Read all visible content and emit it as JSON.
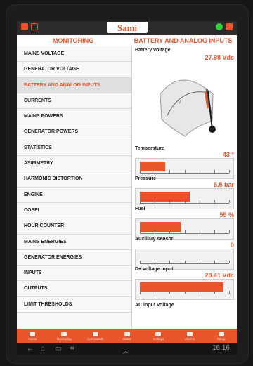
{
  "header": {
    "left_title": "MONITORING",
    "logo_text": "Sami",
    "right_title": "BATTERY AND ANALOG INPUTS"
  },
  "menu": {
    "items": [
      {
        "label": "MAINS VOLTAGE",
        "active": false
      },
      {
        "label": "GENERATOR VOLTAGE",
        "active": false
      },
      {
        "label": "BATTERY AND ANALOG INPUTS",
        "active": true
      },
      {
        "label": "CURRENTS",
        "active": false
      },
      {
        "label": "MAINS POWERS",
        "active": false
      },
      {
        "label": "GENERATOR POWERS",
        "active": false
      },
      {
        "label": "STATISTICS",
        "active": false
      },
      {
        "label": "ASIMMETRY",
        "active": false
      },
      {
        "label": "HARMONIC DISTORTION",
        "active": false
      },
      {
        "label": "ENGINE",
        "active": false
      },
      {
        "label": "COSFI",
        "active": false
      },
      {
        "label": "HOUR COUNTER",
        "active": false
      },
      {
        "label": "MAINS ENERGIES",
        "active": false
      },
      {
        "label": "GENERATOR ENERGIES",
        "active": false
      },
      {
        "label": "INPUTS",
        "active": false
      },
      {
        "label": "OUTPUTS",
        "active": false
      },
      {
        "label": "LIMIT THRESHOLDS",
        "active": false
      }
    ]
  },
  "panel": {
    "battery": {
      "label": "Battery voltage",
      "value": "27.98 Vdc"
    },
    "temperature": {
      "label": "Temperature",
      "value": "43 °",
      "level": 0.28
    },
    "pressure": {
      "label": "Pressure",
      "value": "5.5 bar",
      "level": 0.55
    },
    "fuel": {
      "label": "Fuel",
      "value": "55 %",
      "level": 0.45
    },
    "auxiliary": {
      "label": "Auxiliary sensor",
      "value": "0",
      "level": 0.0
    },
    "dplus": {
      "label": "D+ voltage input",
      "value": "28.41 Vdc",
      "level": 0.92
    },
    "ac": {
      "label": "AC input voltage"
    }
  },
  "tabs": [
    "Home",
    "Monitoring",
    "Commands",
    "Status",
    "Settings",
    "Alarms",
    "Setup"
  ],
  "nav": {
    "time": "16:16"
  }
}
